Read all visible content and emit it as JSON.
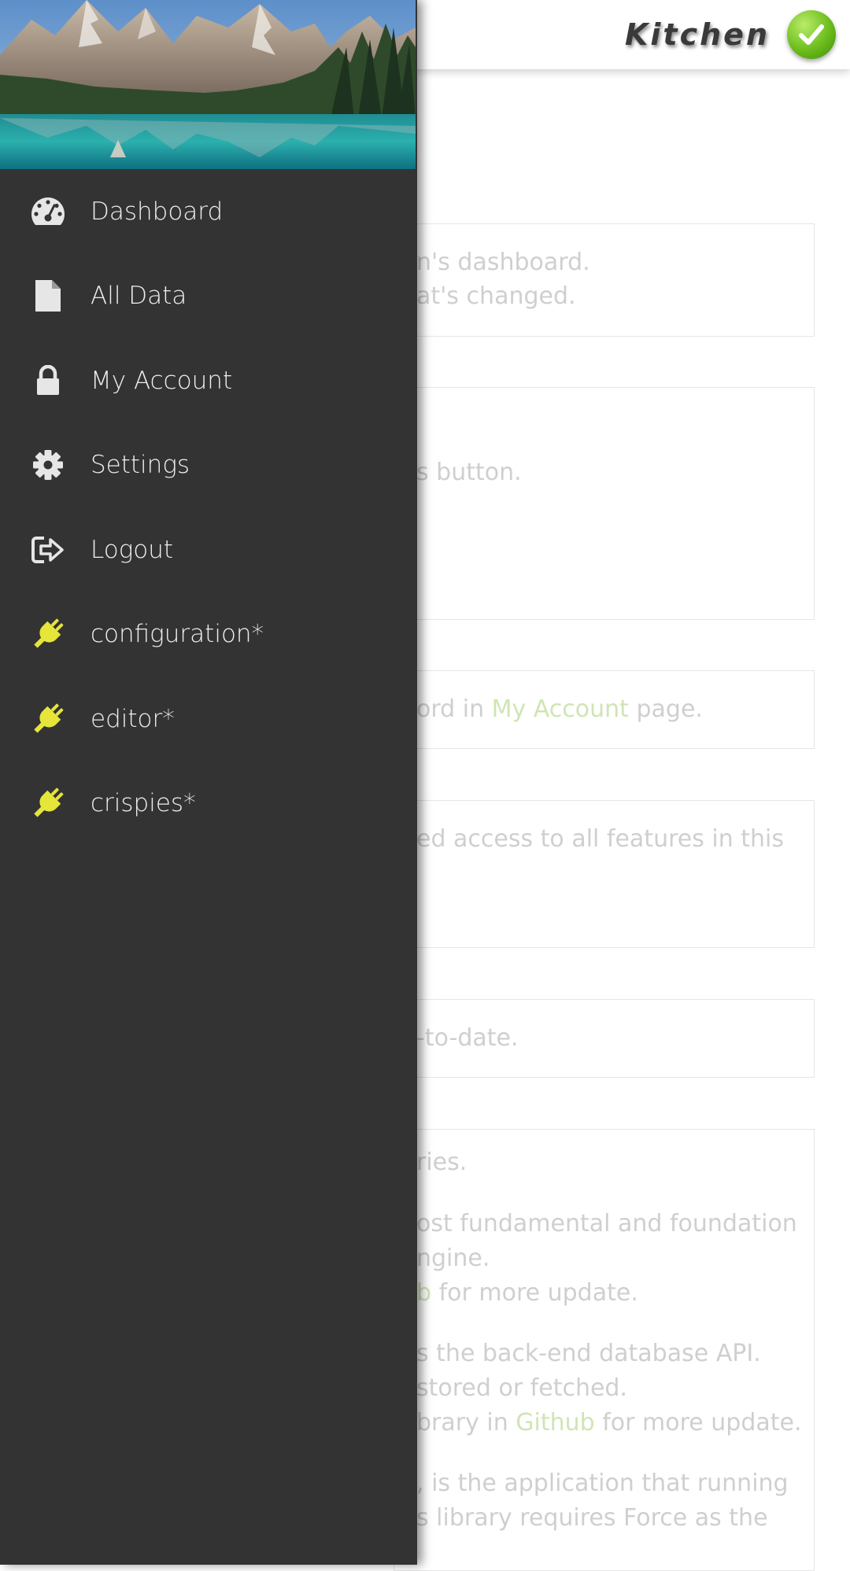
{
  "app": {
    "title": "Kitchen",
    "status_icon": "checkmark-icon",
    "accent_color": "#e6e53a",
    "link_color": "#cfe5b4"
  },
  "drawer": {
    "header_image": "mountain-lake-image",
    "items": [
      {
        "label": "Dashboard",
        "icon": "dashboard-icon"
      },
      {
        "label": "All Data",
        "icon": "file-icon"
      },
      {
        "label": "My Account",
        "icon": "lock-icon"
      },
      {
        "label": "Settings",
        "icon": "gear-icon"
      },
      {
        "label": "Logout",
        "icon": "logout-icon"
      },
      {
        "label": "configuration*",
        "icon": "plug-icon"
      },
      {
        "label": "editor*",
        "icon": "plug-icon"
      },
      {
        "label": "crispies*",
        "icon": "plug-icon"
      }
    ]
  },
  "content": {
    "card1": {
      "line1": "n's dashboard.",
      "line2": "at's changed."
    },
    "card2": {
      "line1": "s button."
    },
    "card3": {
      "before": "ord in ",
      "link": "My Account",
      "after": " page."
    },
    "card4": {
      "line1": "ed access to all features in this"
    },
    "card5": {
      "line1": "-to-date."
    },
    "card6": {
      "line1": "ries.",
      "line2": "ost fundamental and foundation",
      "line3": "ngine.",
      "line4_link": "b",
      "line4_after": " for more update.",
      "line5": "s the back-end database API.",
      "line6": "stored or fetched.",
      "line7_before": "brary in ",
      "line7_link": "Github",
      "line7_after": " for more update.",
      "line8": ", is the application that running",
      "line9": "s library requires Force as the"
    }
  }
}
